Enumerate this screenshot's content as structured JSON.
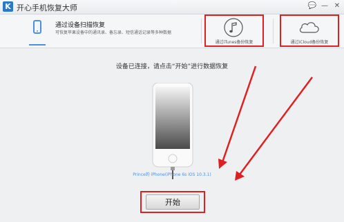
{
  "window": {
    "logo_letter": "K",
    "title": "开心手机恢复大师",
    "controls": {
      "chat": "💬",
      "minimize": "—",
      "close": "✕"
    }
  },
  "modes": {
    "device": {
      "title": "通过设备扫描恢复",
      "desc": "可恢复苹果设备中的通讯录、备忘录、短信通话记录等多种数据"
    },
    "itunes": {
      "label": "通过iTunes备份恢复"
    },
    "icloud": {
      "label": "通过iCloud备份恢复"
    }
  },
  "main": {
    "status": "设备已连接，请点击“开始”进行数据恢复",
    "device_label": "Prince的 iPhone(iPhone 6s iOS 10.3.1)",
    "start_label": "开始"
  },
  "colors": {
    "accent": "#4a90e2",
    "highlight": "#e02020"
  }
}
